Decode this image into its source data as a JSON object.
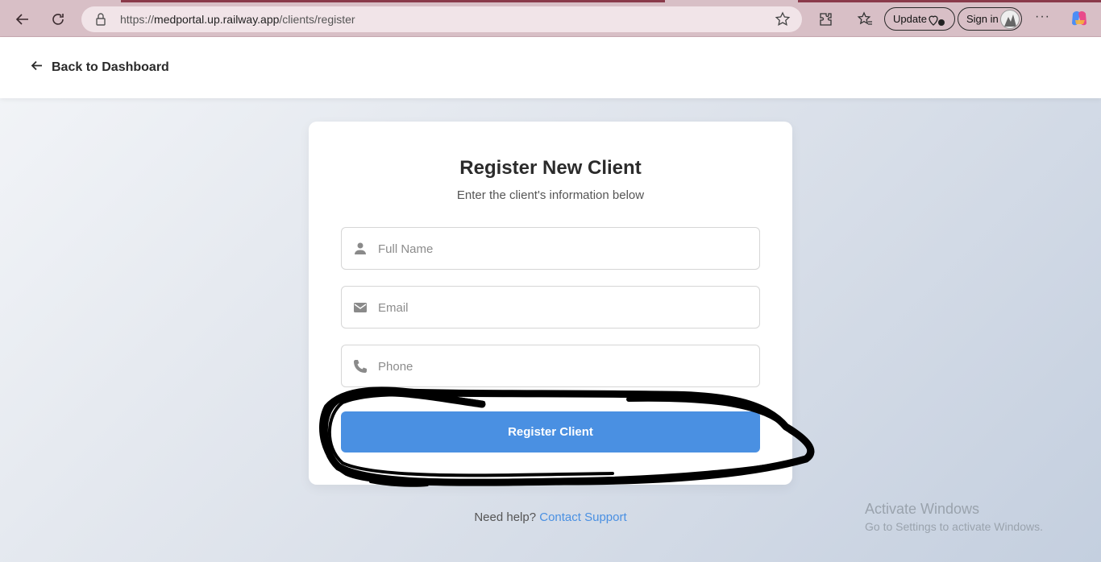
{
  "browser": {
    "url_prefix": "https://",
    "url_host": "medportal.up.railway.app",
    "url_path": "/clients/register",
    "update_label": "Update",
    "signin_label": "Sign in",
    "more_label": "···"
  },
  "header": {
    "back_label": "Back to Dashboard"
  },
  "form": {
    "title": "Register New Client",
    "subtitle": "Enter the client's information below",
    "fields": [
      {
        "placeholder": "Full Name",
        "value": "",
        "icon": "person-icon"
      },
      {
        "placeholder": "Email",
        "value": "",
        "icon": "mail-icon"
      },
      {
        "placeholder": "Phone",
        "value": "",
        "icon": "phone-icon"
      }
    ],
    "submit_label": "Register Client"
  },
  "help": {
    "text": "Need help?",
    "link": "Contact Support"
  },
  "watermark": {
    "line1": "Activate Windows",
    "line2": "Go to Settings to activate Windows."
  },
  "colors": {
    "accent": "#4a90e2",
    "browser_frame": "#d8bfc6",
    "annotation": "#000000"
  }
}
